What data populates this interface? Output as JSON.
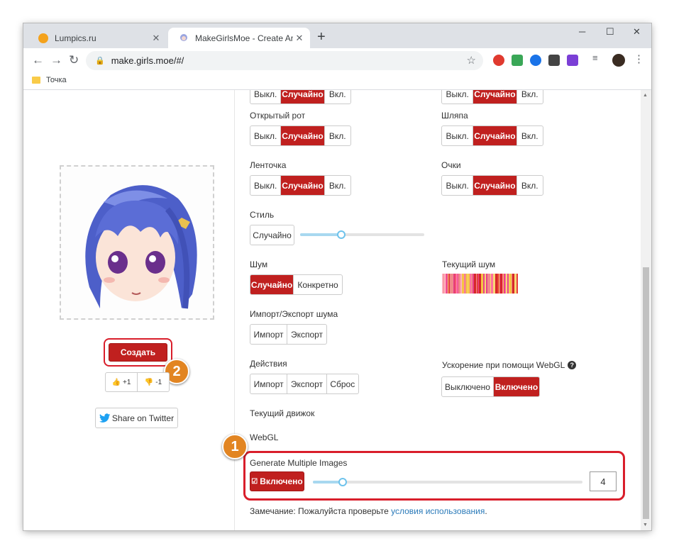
{
  "browser": {
    "tabs": [
      {
        "title": "Lumpics.ru",
        "active": false
      },
      {
        "title": "MakeGirlsMoe - Create Anime Cha",
        "active": true
      }
    ],
    "new_tab": "+",
    "url": "make.girls.moe/#/",
    "bookmark": "Точка",
    "window_controls": {
      "minimize": "─",
      "maximize": "☐",
      "close": "✕"
    },
    "nav": {
      "back": "←",
      "forward": "→",
      "reload": "↻"
    }
  },
  "left_panel": {
    "create_label": "Создать",
    "upvote_label": "+1",
    "downvote_label": "-1",
    "share_label": "Share on Twitter"
  },
  "options": {
    "top_partial_left": [
      "Выкл.",
      "Случайно",
      "Вкл."
    ],
    "top_partial_right": [
      "Выкл.",
      "Случайно",
      "Вкл."
    ],
    "open_mouth": {
      "label": "Открытый рот",
      "choices": [
        "Выкл.",
        "Случайно",
        "Вкл."
      ],
      "selected": "Случайно"
    },
    "hat": {
      "label": "Шляпа",
      "choices": [
        "Выкл.",
        "Случайно",
        "Вкл."
      ],
      "selected": "Случайно"
    },
    "ribbon": {
      "label": "Ленточка",
      "choices": [
        "Выкл.",
        "Случайно",
        "Вкл."
      ],
      "selected": "Случайно"
    },
    "glasses": {
      "label": "Очки",
      "choices": [
        "Выкл.",
        "Случайно",
        "Вкл."
      ],
      "selected": "Случайно"
    },
    "style": {
      "label": "Стиль",
      "button": "Случайно",
      "slider_value": 0.33
    },
    "noise": {
      "label": "Шум",
      "choices": [
        "Случайно",
        "Конкретно"
      ],
      "selected": "Случайно"
    },
    "current_noise": {
      "label": "Текущий шум"
    },
    "noise_io": {
      "label": "Импорт/Экспорт шума",
      "choices": [
        "Импорт",
        "Экспорт"
      ]
    },
    "actions": {
      "label": "Действия",
      "choices": [
        "Импорт",
        "Экспорт",
        "Сброс"
      ]
    },
    "webgl_accel": {
      "label": "Ускорение при помощи WebGL",
      "choices": [
        "Выключено",
        "Включено"
      ],
      "selected": "Включено"
    },
    "engine": {
      "label": "Текущий движок",
      "value": "WebGL"
    },
    "multiple": {
      "label": "Generate Multiple Images",
      "button": "Включено",
      "count": "4",
      "slider_value": 0.11
    }
  },
  "note": {
    "text": "Замечание: Пожалуйста проверьте ",
    "link": "условия использования",
    "end": "."
  },
  "annotations": {
    "step1": "1",
    "step2": "2"
  },
  "colors": {
    "accent_red": "#c0201f",
    "highlight_red": "#d91e2b",
    "badge_orange": "#e28522",
    "slider_blue": "#6ec3ec"
  }
}
